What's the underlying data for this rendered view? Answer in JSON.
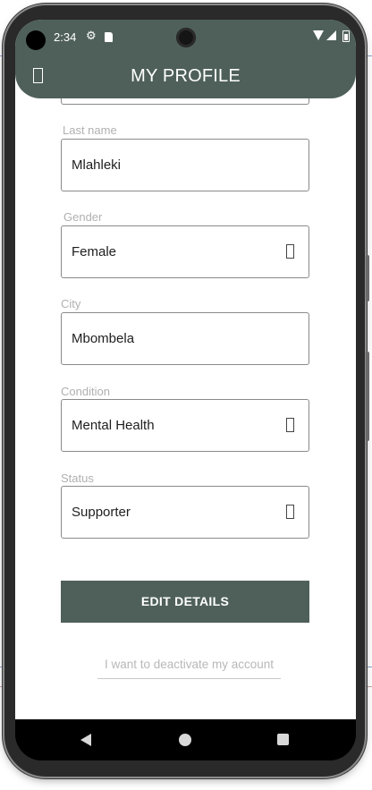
{
  "status_bar": {
    "time": "2:34"
  },
  "header": {
    "title": "MY PROFILE"
  },
  "form": {
    "fields": [
      {
        "label": "Last name",
        "value": "Mlahleki"
      },
      {
        "label": "Gender",
        "value": "Female"
      },
      {
        "label": "City",
        "value": "Mbombela"
      },
      {
        "label": "Condition",
        "value": "Mental Health"
      },
      {
        "label": "Status",
        "value": "Supporter"
      }
    ]
  },
  "actions": {
    "edit_label": "EDIT DETAILS",
    "deactivate_label": "I want to deactivate my account"
  },
  "colors": {
    "accent": "#4f605b"
  },
  "icons": {
    "back": "back-icon",
    "dropdown": "dropdown-icon",
    "settings": "gear-icon"
  }
}
